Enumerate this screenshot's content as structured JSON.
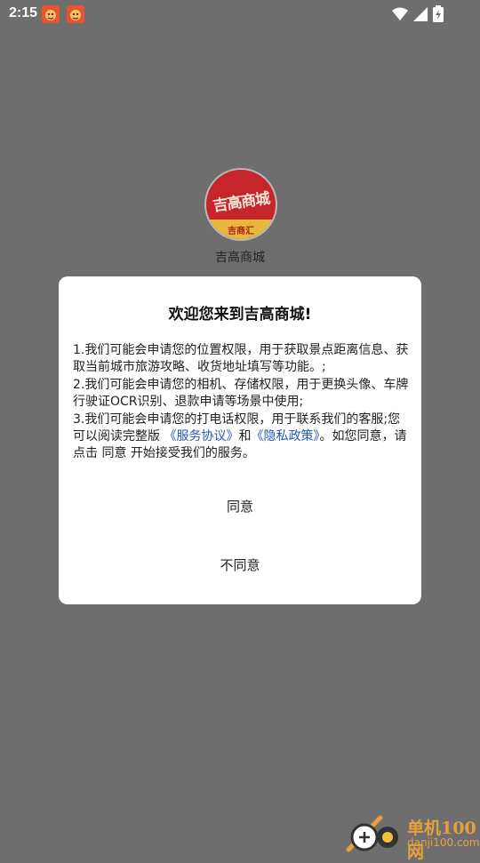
{
  "status_bar": {
    "time": "2:15",
    "icons": [
      "app-notification-icon",
      "app-notification-icon",
      "wifi-icon",
      "signal-icon",
      "battery-icon"
    ]
  },
  "splash": {
    "logo_title": "吉高商城",
    "logo_subtitle": "吉商汇",
    "app_name": "吉高商城"
  },
  "dialog": {
    "title": "欢迎您来到吉高商城!",
    "line1": "1.我们可能会申请您的位置权限，用于获取景点距离信息、获取当前城市旅游攻略、收货地址填写等功能。;",
    "line2": "2.我们可能会申请您的相机、存储权限，用于更换头像、车牌行驶证OCR识别、退款申请等场景中使用;",
    "line3": "3.我们可能会申请您的打电话权限，用于联系我们的客服;您可以阅读完整版",
    "service_link": "《服务协议》",
    "and": "和",
    "privacy_link": "《隐私政策》",
    "tail": "。如您同意，请点击 同意 开始接受我们的服务。",
    "agree_label": "同意",
    "disagree_label": "不同意"
  },
  "watermark": {
    "brand": "单机100网",
    "url": "danji100.com"
  },
  "colors": {
    "overlay": "#6e6e6e",
    "link": "#2756b8",
    "logo_red": "#c6252b",
    "logo_gold": "#e8b83c",
    "watermark": "#e8a03a"
  }
}
